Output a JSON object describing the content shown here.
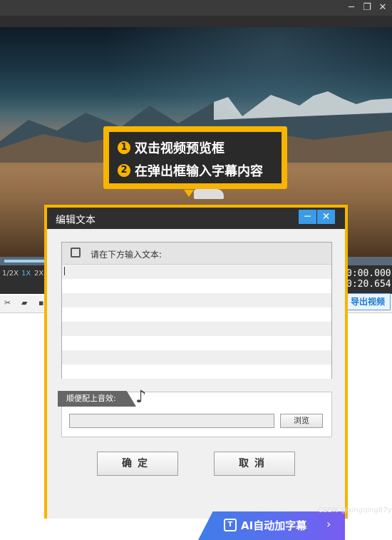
{
  "window": {
    "controls": [
      "─",
      "❐",
      "✕"
    ]
  },
  "callout": {
    "steps": [
      {
        "num": "1",
        "text": "双击视频预览框"
      },
      {
        "num": "2",
        "text": "在弹出框输入字幕内容"
      }
    ]
  },
  "player": {
    "speeds": [
      "1/2X",
      "1X",
      "2X"
    ],
    "time_current": "0:00.000",
    "time_total": "0:20.654",
    "export_label": "导出视频"
  },
  "dialog": {
    "title": "编辑文本",
    "min_label": "─",
    "close_label": "✕",
    "text_prompt": "请在下方输入文本:",
    "text_value": "",
    "sound_label": "顺便配上音效:",
    "sound_path": "",
    "browse_label": "浏览",
    "ok_label": "确定",
    "cancel_label": "取消",
    "ai_label": "AI自动加字幕"
  },
  "watermark": "CSDN @xingqing87y",
  "colors": {
    "accent": "#f7b400",
    "dialog_title": "#2f2f2f",
    "close_button": "#3a9be8"
  }
}
